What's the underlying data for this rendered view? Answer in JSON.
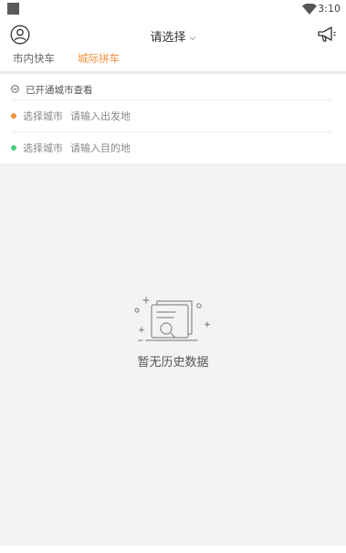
{
  "status_bar": {
    "time": "3:10",
    "icons": [
      "notification-square-icon",
      "wifi-icon"
    ]
  },
  "header": {
    "title": "请选择",
    "left_icon": "user-icon",
    "right_icon": "megaphone-icon",
    "tabs": [
      {
        "label": "市内快车",
        "active": false
      },
      {
        "label": "城际拼车",
        "active": true
      }
    ]
  },
  "route": {
    "hint": "已开通城市查看",
    "origin": {
      "city": "选择城市",
      "placeholder": "请输入出发地",
      "dot_color": "#f0913f"
    },
    "destination": {
      "city": "选择城市",
      "placeholder": "请输入目的地",
      "dot_color": "#4cd080"
    }
  },
  "empty_state": {
    "text": "暂无历史数据",
    "icon": "no-history-icon"
  },
  "colors": {
    "accent": "#f0913f",
    "destination": "#4cd080"
  }
}
